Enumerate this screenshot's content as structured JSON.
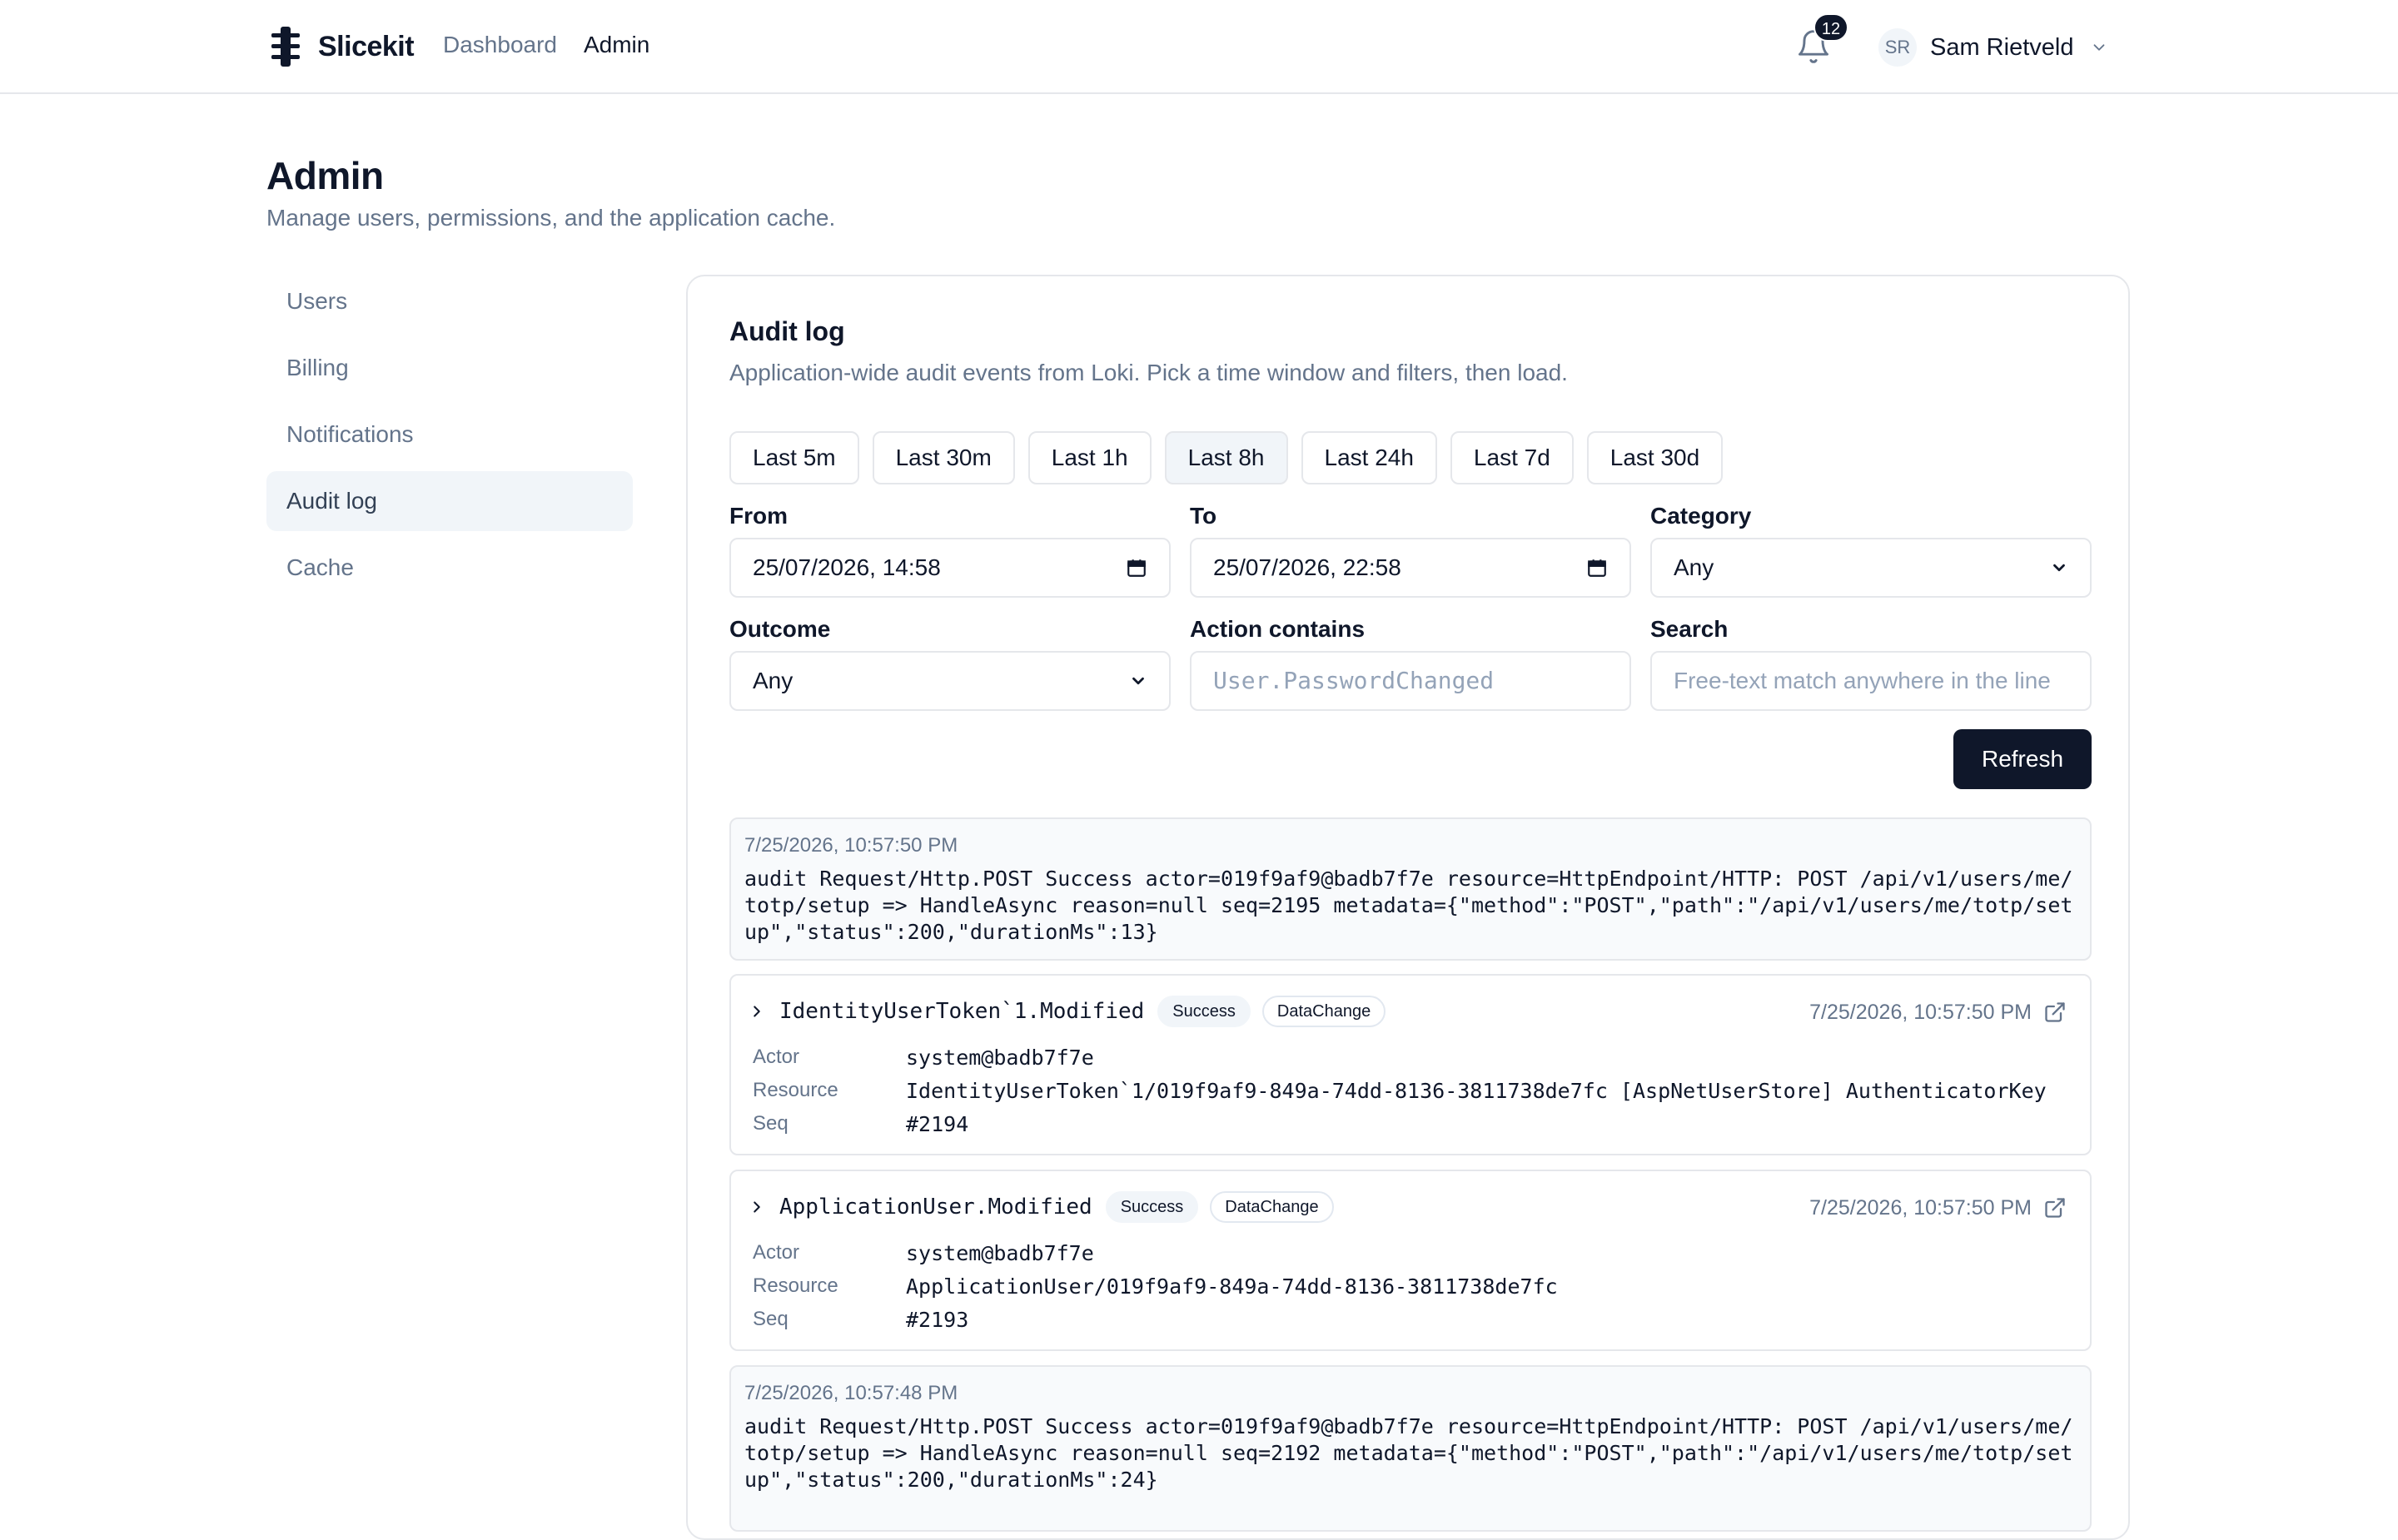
{
  "header": {
    "brand": "Slicekit",
    "nav": [
      {
        "label": "Dashboard",
        "active": false
      },
      {
        "label": "Admin",
        "active": true
      }
    ],
    "notifications_count": "12",
    "user": {
      "initials": "SR",
      "name": "Sam Rietveld"
    }
  },
  "page": {
    "title": "Admin",
    "subtitle": "Manage users, permissions, and the application cache."
  },
  "sidebar": {
    "items": [
      {
        "label": "Users",
        "active": false
      },
      {
        "label": "Billing",
        "active": false
      },
      {
        "label": "Notifications",
        "active": false
      },
      {
        "label": "Audit log",
        "active": true
      },
      {
        "label": "Cache",
        "active": false
      }
    ]
  },
  "audit": {
    "title": "Audit log",
    "subtitle": "Application-wide audit events from Loki. Pick a time window and filters, then load.",
    "ranges": [
      {
        "label": "Last 5m",
        "active": false
      },
      {
        "label": "Last 30m",
        "active": false
      },
      {
        "label": "Last 1h",
        "active": false
      },
      {
        "label": "Last 8h",
        "active": true
      },
      {
        "label": "Last 24h",
        "active": false
      },
      {
        "label": "Last 7d",
        "active": false
      },
      {
        "label": "Last 30d",
        "active": false
      }
    ],
    "filters": {
      "from_label": "From",
      "from_value": "25/07/2026, 14:58",
      "to_label": "To",
      "to_value": "25/07/2026, 22:58",
      "category_label": "Category",
      "category_value": "Any",
      "outcome_label": "Outcome",
      "outcome_value": "Any",
      "action_label": "Action contains",
      "action_placeholder": "User.PasswordChanged",
      "search_label": "Search",
      "search_placeholder": "Free-text match anywhere in the line"
    },
    "refresh_label": "Refresh",
    "raw_entries": [
      {
        "time": "7/25/2026, 10:57:50 PM",
        "text": "audit Request/Http.POST Success actor=019f9af9@badb7f7e resource=HttpEndpoint/HTTP: POST /api/v1/users/me/totp/setup => HandleAsync reason=null seq=2195 metadata={\"method\":\"POST\",\"path\":\"/api/v1/users/me/totp/setup\",\"status\":200,\"durationMs\":13}"
      },
      {
        "time": "7/25/2026, 10:57:48 PM",
        "text": "audit Request/Http.POST Success actor=019f9af9@badb7f7e resource=HttpEndpoint/HTTP: POST /api/v1/users/me/totp/setup => HandleAsync reason=null seq=2192 metadata={\"method\":\"POST\",\"path\":\"/api/v1/users/me/totp/setup\",\"status\":200,\"durationMs\":24}"
      }
    ],
    "entries": [
      {
        "action": "IdentityUserToken`1.Modified",
        "outcome": "Success",
        "category": "DataChange",
        "time": "7/25/2026, 10:57:50 PM",
        "actor_label": "Actor",
        "actor": "system@badb7f7e",
        "resource_label": "Resource",
        "resource": "IdentityUserToken`1/019f9af9-849a-74dd-8136-3811738de7fc [AspNetUserStore] AuthenticatorKey",
        "seq_label": "Seq",
        "seq": "#2194"
      },
      {
        "action": "ApplicationUser.Modified",
        "outcome": "Success",
        "category": "DataChange",
        "time": "7/25/2026, 10:57:50 PM",
        "actor_label": "Actor",
        "actor": "system@badb7f7e",
        "resource_label": "Resource",
        "resource": "ApplicationUser/019f9af9-849a-74dd-8136-3811738de7fc",
        "seq_label": "Seq",
        "seq": "#2193"
      }
    ]
  },
  "icons": {
    "brand": "slicekit-logo-icon",
    "notifications": "bell-icon",
    "user_menu": "chevron-down-icon",
    "date_picker": "calendar-icon",
    "expand": "chevron-right-icon",
    "open_entry": "external-link-icon"
  },
  "colors": {
    "primary": "#0f172a",
    "muted_text": "#64748b",
    "border": "#e5e7eb",
    "active_bg": "#f1f5f9"
  }
}
